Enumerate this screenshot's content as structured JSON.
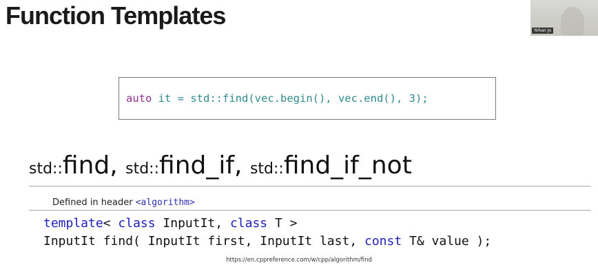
{
  "slide": {
    "title": "Function Templates",
    "url": "https://en.cppreference.com/w/cpp/algorithm/find"
  },
  "webcam": {
    "name": "Yohan Jo"
  },
  "code_example": {
    "auto_kw": "auto",
    "line_rest": " it = ",
    "ns_prefix": "std::",
    "call": "find(vec.begin(), vec.end(), 3);"
  },
  "functions": {
    "std1": "std::",
    "name1": "find",
    "sep1": ", ",
    "std2": "std::",
    "name2": "find_if",
    "sep2": ", ",
    "std3": "std::",
    "name3": "find_if_not"
  },
  "reference": {
    "defined_label": "Defined in header ",
    "header": "<algorithm>",
    "sig1_template": "template",
    "sig1_lt": "< ",
    "sig1_class1": "class",
    "sig1_mid": " InputIt, ",
    "sig1_class2": "class",
    "sig1_end": " T >",
    "sig2_start": "InputIt find( InputIt first, InputIt last, ",
    "sig2_const": "const",
    "sig2_end": " T& value );"
  },
  "colors": {
    "keyword_purple": "#8e2f8e",
    "keyword_teal": "#2f8a8e",
    "keyword_blue": "#1d1dbb"
  }
}
